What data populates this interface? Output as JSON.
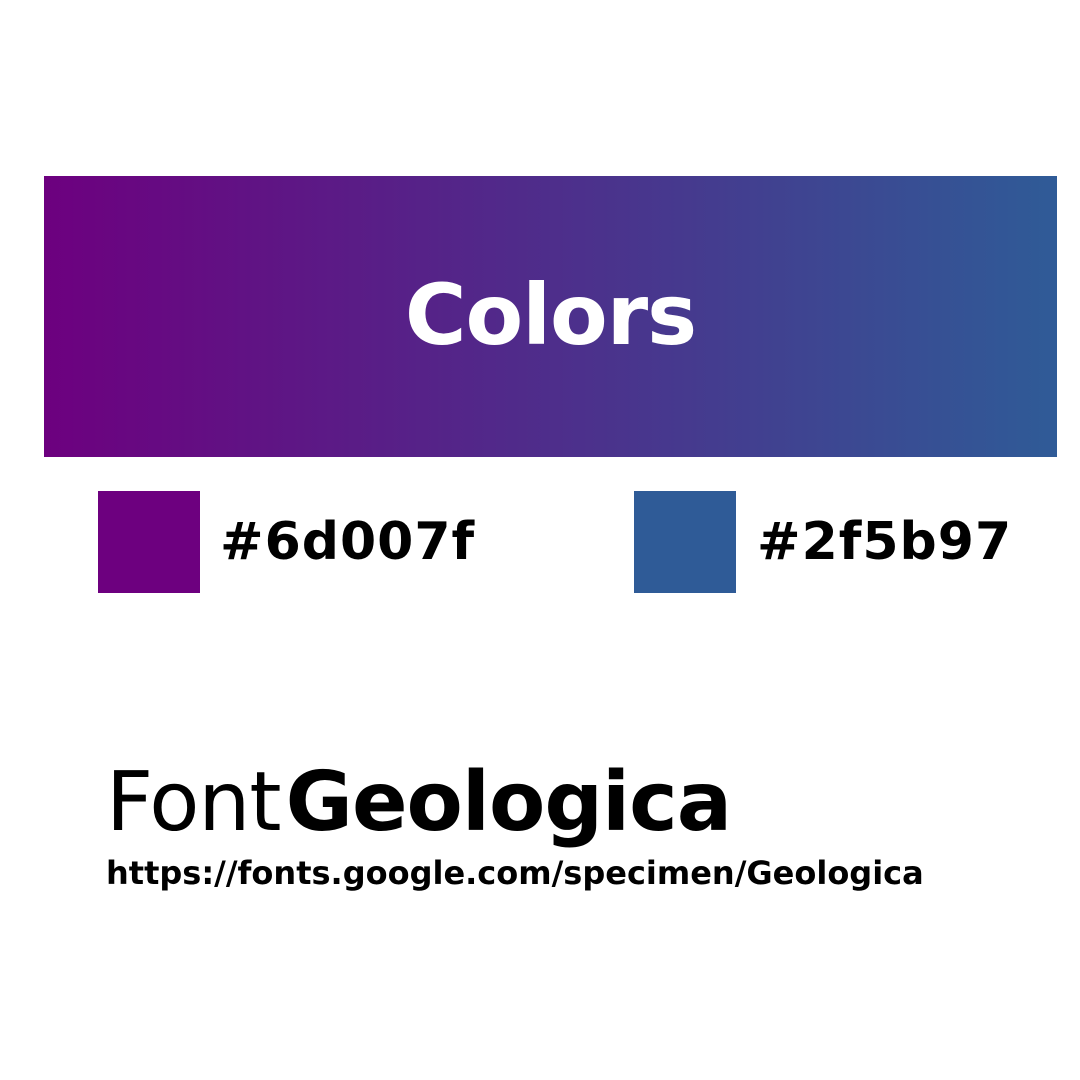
{
  "banner": {
    "title": "Colors",
    "gradient_start": "#6d007f",
    "gradient_end": "#2f5b97"
  },
  "colors": [
    {
      "hex_label": "#6d007f",
      "swatch_color": "#6d007f"
    },
    {
      "hex_label": "#2f5b97",
      "swatch_color": "#2f5b97"
    }
  ],
  "font": {
    "label": "Font",
    "name": "Geologica",
    "url": "https://fonts.google.com/specimen/Geologica"
  }
}
